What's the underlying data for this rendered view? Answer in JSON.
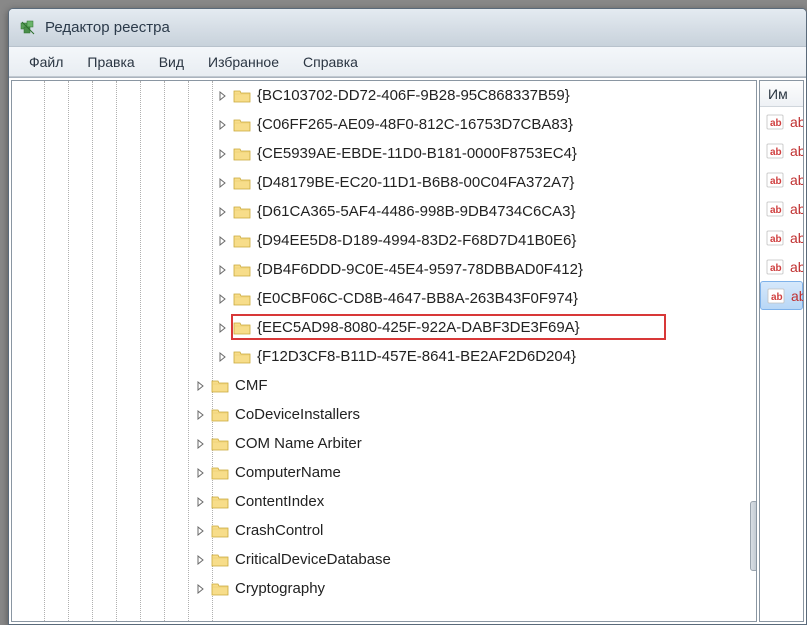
{
  "window": {
    "title": "Редактор реестра"
  },
  "menu": {
    "items": [
      "Файл",
      "Правка",
      "Вид",
      "Избранное",
      "Справка"
    ]
  },
  "tree": {
    "guid_indent": 205,
    "named_indent": 183,
    "guid_items": [
      "{BC103702-DD72-406F-9B28-95C868337B59}",
      "{C06FF265-AE09-48F0-812C-16753D7CBA83}",
      "{CE5939AE-EBDE-11D0-B181-0000F8753EC4}",
      "{D48179BE-EC20-11D1-B6B8-00C04FA372A7}",
      "{D61CA365-5AF4-4486-998B-9DB4734C6CA3}",
      "{D94EE5D8-D189-4994-83D2-F68D7D41B0E6}",
      "{DB4F6DDD-9C0E-45E4-9597-78DBBAD0F412}",
      "{E0CBF06C-CD8B-4647-BB8A-263B43F0F974}",
      "{EEC5AD98-8080-425F-922A-DABF3DE3F69A}",
      "{F12D3CF8-B11D-457E-8641-BE2AF2D6D204}"
    ],
    "highlighted_index": 8,
    "named_items": [
      "CMF",
      "CoDeviceInstallers",
      "COM Name Arbiter",
      "ComputerName",
      "ContentIndex",
      "CrashControl",
      "CriticalDeviceDatabase",
      "Cryptography"
    ]
  },
  "right": {
    "header": "Им",
    "value_prefix": "ab",
    "values_count": 7,
    "selected_index": 6
  }
}
